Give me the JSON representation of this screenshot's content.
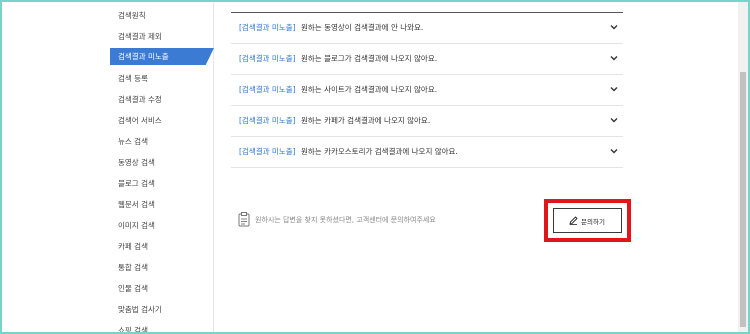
{
  "sidebar": {
    "items": [
      {
        "label": "검색원칙"
      },
      {
        "label": "검색결과 제외"
      },
      {
        "label": "검색결과 미노출",
        "active": true
      },
      {
        "label": "검색 등록"
      },
      {
        "label": "검색결과 수정"
      },
      {
        "label": "검색어 서비스"
      },
      {
        "label": "뉴스 검색"
      },
      {
        "label": "동영상 검색"
      },
      {
        "label": "블로그 검색"
      },
      {
        "label": "웹문서 검색"
      },
      {
        "label": "이미지 검색"
      },
      {
        "label": "카페 검색"
      },
      {
        "label": "통합 검색"
      },
      {
        "label": "인물 검색"
      },
      {
        "label": "맞춤법 검사기"
      },
      {
        "label": "쇼핑 검색"
      }
    ]
  },
  "faq": {
    "items": [
      {
        "tag": "[검색결과 미노출]",
        "text": "원하는 동영상이 검색결과에 안 나와요."
      },
      {
        "tag": "[검색결과 미노출]",
        "text": "원하는 블로그가 검색결과에 나오지 않아요."
      },
      {
        "tag": "[검색결과 미노출]",
        "text": "원하는 사이트가 검색결과에 나오지 않아요."
      },
      {
        "tag": "[검색결과 미노출]",
        "text": "원하는 카페가 검색결과에 나오지 않아요."
      },
      {
        "tag": "[검색결과 미노출]",
        "text": "원하는 카카오스토리가 검색결과에 나오지 않아요."
      }
    ],
    "chevron_icon": "chevron-down-icon"
  },
  "help": {
    "icon": "clipboard-icon",
    "text": "원하시는 답변을 찾지 못하셨다면, 고객센터에 문의하여주세요"
  },
  "ask_button": {
    "icon": "pencil-icon",
    "label": "문의하기",
    "highlight_color": "#e0161b"
  },
  "colors": {
    "accent": "#3b7bd4",
    "tag": "#2f77d2",
    "frame": "#7ad3c9"
  }
}
